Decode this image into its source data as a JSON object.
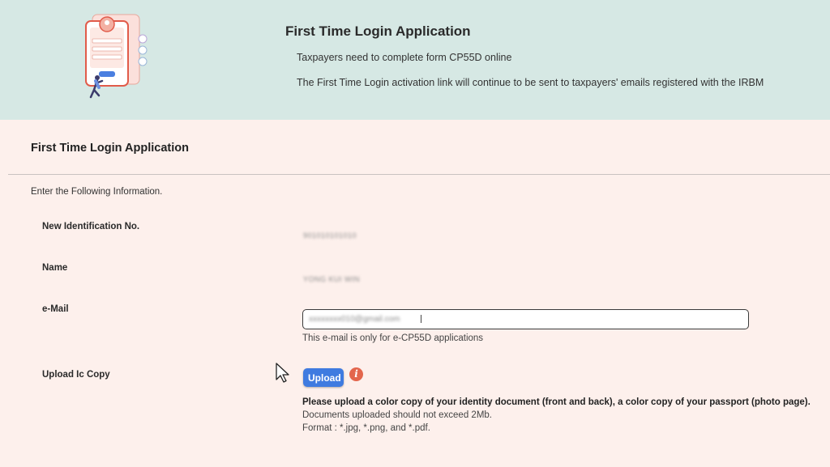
{
  "banner": {
    "title": "First Time Login Application",
    "line1": "Taxpayers need to complete form CP55D online",
    "line2": "The First Time Login activation link will continue to be sent to taxpayers' emails registered with the IRBM"
  },
  "form": {
    "section_title": "First Time Login Application",
    "instruction": "Enter the Following Information.",
    "fields": {
      "id_label": "New Identification No.",
      "id_value": "901010101010",
      "name_label": "Name",
      "name_value": "YONG KUI WIN",
      "email_label": "e-Mail",
      "email_value": "xxxxxxxx010@gmail.com",
      "email_hint": "This e-mail is only for e-CP55D applications",
      "upload_label": "Upload Ic Copy"
    },
    "upload": {
      "button_label": "Upload",
      "info_icon": "i",
      "note_bold": "Please upload a color copy of your identity document (front and back), a color copy of your passport (photo page).",
      "note_size": "Documents uploaded should not exceed 2Mb.",
      "note_format": "Format : *.jpg, *.png, and *.pdf."
    }
  },
  "colors": {
    "banner_bg": "#d6e8e4",
    "page_bg": "#fdf0ec",
    "upload_button": "#3f7be0",
    "info_icon": "#e3664c"
  },
  "icons": [
    "login-illustration",
    "info-icon",
    "mouse-cursor-icon"
  ]
}
